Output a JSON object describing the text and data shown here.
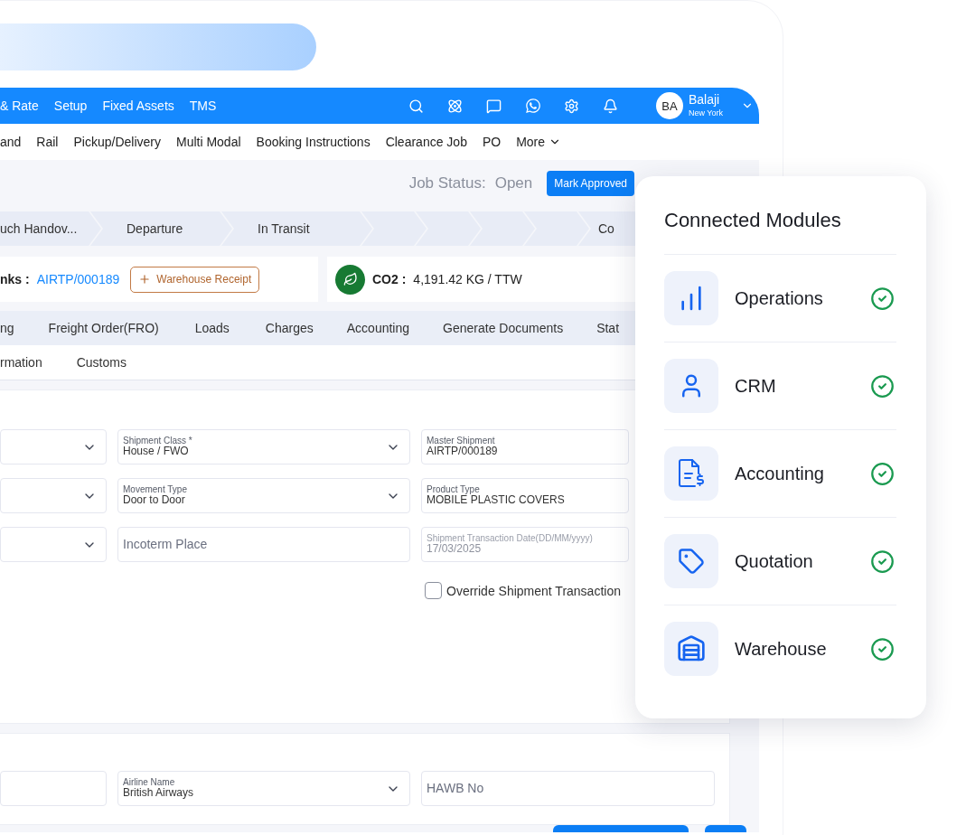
{
  "top_nav": {
    "menu": [
      "& Rate",
      "Setup",
      "Fixed Assets",
      "TMS"
    ],
    "user": {
      "initials": "BA",
      "name": "Balaji",
      "location": "New York"
    }
  },
  "module_nav": {
    "items": [
      "and",
      "Rail",
      "Pickup/Delivery",
      "Multi Modal",
      "Booking Instructions",
      "Clearance Job",
      "PO"
    ],
    "more": "More"
  },
  "job_status": {
    "label": "Job Status:",
    "value": "Open",
    "action": "Mark Approved"
  },
  "stepper": {
    "steps": [
      "uch Handov...",
      "Departure",
      "In Transit"
    ],
    "last_step": "Co"
  },
  "links": {
    "label": "nks :",
    "link": "AIRTP/000189",
    "button": "Warehouse Receipt"
  },
  "emission": {
    "label": "CO2 :",
    "value": "4,191.42 KG / TTW"
  },
  "tabs": [
    "ng",
    "Freight Order(FRO)",
    "Loads",
    "Charges",
    "Accounting",
    "Generate Documents",
    "Stat"
  ],
  "sub_tabs": [
    "rmation",
    "Customs"
  ],
  "shipment_form": {
    "fields": [
      {
        "kind": "select"
      },
      {
        "kind": "select",
        "label": "Shipment Class *",
        "value": "House / FWO"
      },
      {
        "kind": "text",
        "label": "Master Shipment",
        "value": "AIRTP/000189"
      },
      {
        "kind": "select"
      },
      {
        "kind": "select",
        "label": "Movement Type",
        "value": "Door to Door"
      },
      {
        "kind": "text",
        "label": "Product Type",
        "value": "MOBILE PLASTIC COVERS"
      },
      {
        "kind": "select"
      },
      {
        "kind": "text",
        "placeholder": "Incoterm Place"
      },
      {
        "kind": "text",
        "label": "Shipment Transaction Date(DD/MM/yyyy)",
        "value": "17/03/2025",
        "disabled": true
      }
    ],
    "override": {
      "label": "Override Shipment Transaction",
      "checked": false
    }
  },
  "carrier_form": {
    "fields": [
      {
        "kind": "text"
      },
      {
        "kind": "select",
        "label": "Airline Name",
        "value": "British Airways"
      },
      {
        "kind": "text",
        "placeholder": "HAWB No"
      }
    ]
  },
  "connected_modules": {
    "title": "Connected Modules",
    "modules": [
      {
        "name": "Operations",
        "connected": true
      },
      {
        "name": "CRM",
        "connected": true
      },
      {
        "name": "Accounting",
        "connected": true
      },
      {
        "name": "Quotation",
        "connected": true
      },
      {
        "name": "Warehouse",
        "connected": true
      }
    ]
  }
}
